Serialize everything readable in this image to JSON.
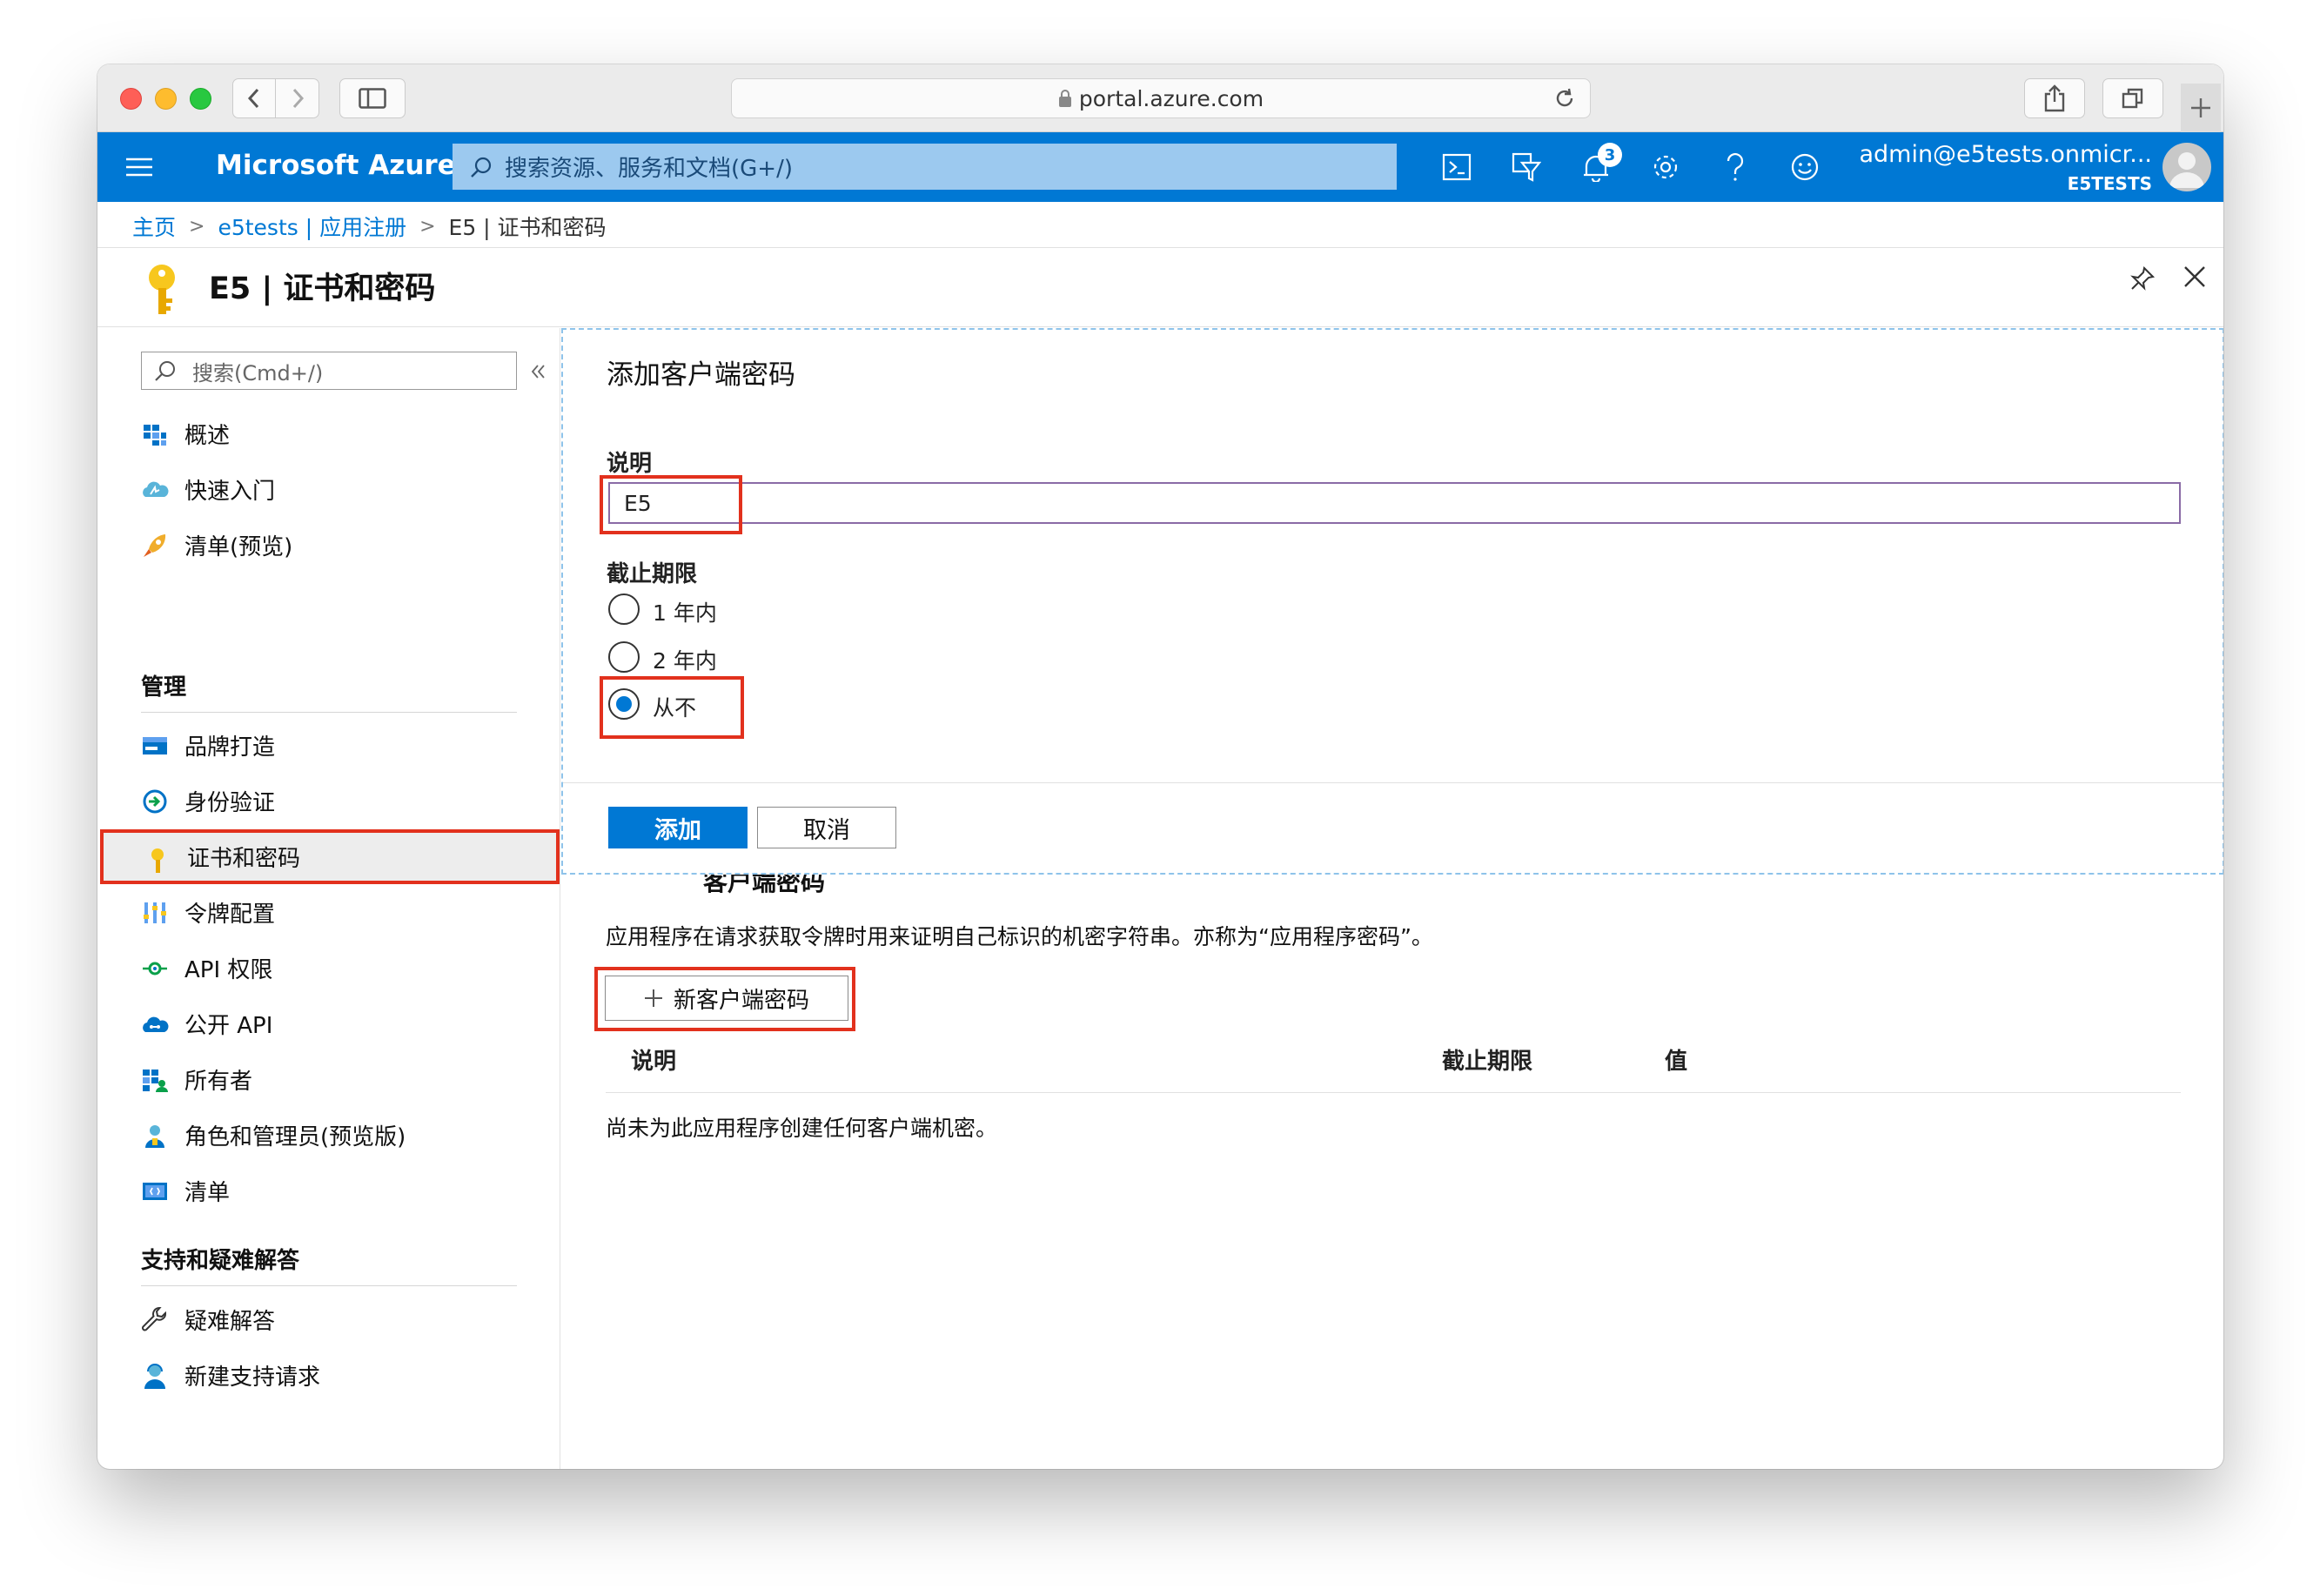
{
  "browser": {
    "url": "portal.azure.com"
  },
  "azure": {
    "brand": "Microsoft Azure",
    "search_placeholder": "搜索资源、服务和文档(G+/)",
    "notification_count": "3",
    "user_name": "admin@e5tests.onmicr...",
    "tenant": "E5TESTS"
  },
  "breadcrumb": {
    "home": "主页",
    "parent": "e5tests | 应用注册",
    "current": "E5 | 证书和密码"
  },
  "page": {
    "title": "E5 | 证书和密码"
  },
  "sidebar": {
    "search_placeholder": "搜索(Cmd+/)",
    "items": [
      {
        "label": "概述",
        "icon": "overview-icon"
      },
      {
        "label": "快速入门",
        "icon": "quickstart-cloud-icon"
      },
      {
        "label": "清单(预览)",
        "icon": "rocket-icon"
      }
    ],
    "manage_title": "管理",
    "manage_items": [
      {
        "label": "品牌打造",
        "icon": "branding-icon"
      },
      {
        "label": "身份验证",
        "icon": "authentication-icon"
      },
      {
        "label": "证书和密码",
        "icon": "key-icon"
      },
      {
        "label": "令牌配置",
        "icon": "token-bars-icon"
      },
      {
        "label": "API 权限",
        "icon": "api-permission-icon"
      },
      {
        "label": "公开 API",
        "icon": "cloud-api-icon"
      },
      {
        "label": "所有者",
        "icon": "owners-icon"
      },
      {
        "label": "角色和管理员(预览版)",
        "icon": "roles-icon"
      },
      {
        "label": "清单",
        "icon": "manifest-icon"
      }
    ],
    "support_title": "支持和疑难解答",
    "support_items": [
      {
        "label": "疑难解答",
        "icon": "wrench-icon"
      },
      {
        "label": "新建支持请求",
        "icon": "support-person-icon"
      }
    ]
  },
  "dialog": {
    "title": "添加客户端密码",
    "description_label": "说明",
    "description_value": "E5",
    "expiry_label": "截止期限",
    "options": [
      "1 年内",
      "2 年内",
      "从不"
    ],
    "selected_option": "从不",
    "add_button": "添加",
    "cancel_button": "取消"
  },
  "client_secrets": {
    "title": "客户端密码",
    "description": "应用程序在请求获取令牌时用来证明自己标识的机密字符串。亦称为“应用程序密码”。",
    "new_button": "新客户端密码",
    "columns": [
      "说明",
      "截止期限",
      "值"
    ],
    "empty_message": "尚未为此应用程序创建任何客户端机密。"
  },
  "colors": {
    "azure_blue": "#0078d4",
    "highlight_red": "#e2311d"
  }
}
